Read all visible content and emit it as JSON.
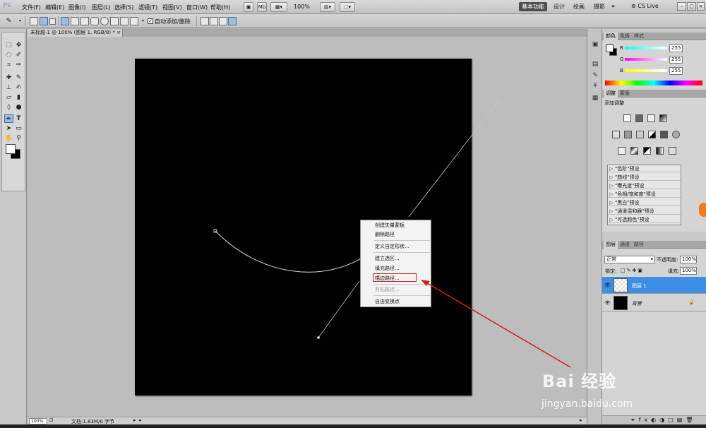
{
  "app": {
    "logo": "Ps"
  },
  "menu": [
    "文件(F)",
    "编辑(E)",
    "图像(I)",
    "图层(L)",
    "选择(S)",
    "滤镜(T)",
    "视图(V)",
    "窗口(W)",
    "帮助(H)"
  ],
  "appbar": {
    "zoom": "100%",
    "workspaces": [
      "基本功能",
      "设计",
      "绘画",
      "摄影"
    ],
    "more": "»",
    "cs_live": "CS Live"
  },
  "options": {
    "auto_add_delete_label": "自动添加/删除",
    "auto_add_delete_checked": "✓"
  },
  "document": {
    "tab_title": "未标题-1 @ 100% (图层 1, RGB/8) *",
    "tab_close": "×",
    "status_zoom": "100%",
    "status_info": "文档:1.83M/0 字节"
  },
  "context_menu": {
    "items": [
      {
        "label": "创建矢量蒙板",
        "disabled": false
      },
      {
        "label": "删除路径",
        "disabled": false
      },
      {
        "label": "定义自定形状...",
        "disabled": false
      },
      {
        "label": "建立选区...",
        "disabled": false
      },
      {
        "label": "填充路径...",
        "disabled": false
      },
      {
        "label": "描边路径...",
        "disabled": false
      },
      {
        "label": "剪贴路径...",
        "disabled": true
      },
      {
        "label": "自由变换点",
        "disabled": false
      }
    ]
  },
  "color_panel": {
    "tabs": [
      "颜色",
      "色板",
      "样式"
    ],
    "channels": [
      {
        "label": "R",
        "value": "255"
      },
      {
        "label": "G",
        "value": "255"
      },
      {
        "label": "B",
        "value": "255"
      }
    ]
  },
  "adjust_panel": {
    "tabs": [
      "调整",
      "蒙版"
    ],
    "title": "添加调整",
    "presets": [
      "\"色阶\"预设",
      "\"曲线\"预设",
      "\"曝光度\"预设",
      "\"色相/饱和度\"预设",
      "\"黑白\"预设",
      "\"通道混和器\"预设",
      "\"可选颜色\"预设"
    ]
  },
  "layers_panel": {
    "tabs": [
      "图层",
      "通道",
      "路径"
    ],
    "blend_mode": "正常",
    "opacity_label": "不透明度:",
    "opacity_value": "100%",
    "lock_label": "锁定:",
    "fill_label": "填充:",
    "fill_value": "100%",
    "layers": [
      {
        "name": "图层 1",
        "selected": true,
        "type": "transparent"
      },
      {
        "name": "背景",
        "selected": false,
        "type": "black"
      }
    ]
  },
  "watermark": {
    "logo": "Bai 经验",
    "url": "jingyan.baidu.com"
  }
}
